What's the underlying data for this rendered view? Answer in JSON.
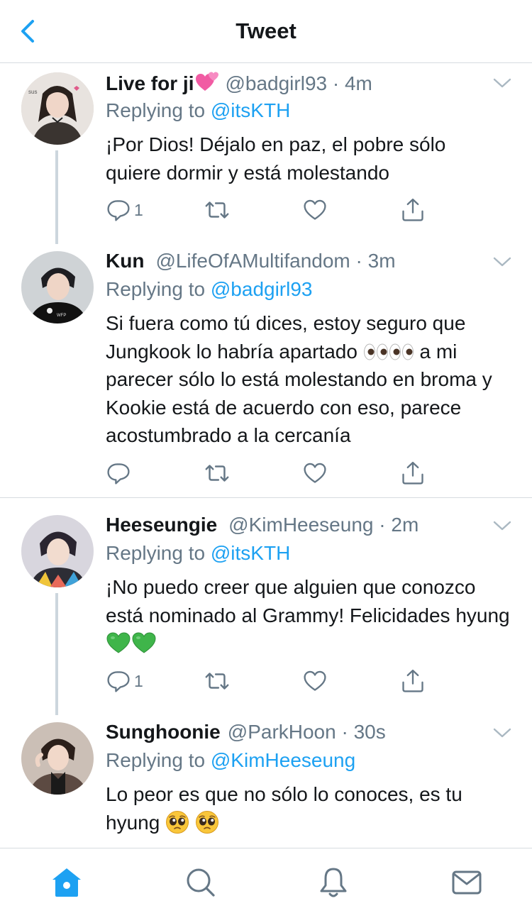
{
  "header": {
    "title": "Tweet"
  },
  "tweets": [
    {
      "name": "Live for ji",
      "handle": "@badgirl93",
      "time": "· 4m",
      "replying_prefix": "Replying to",
      "replying_to": "@itsKTH",
      "text": "¡Por Dios! Déjalo en paz, el pobre sólo quiere dormir y está molestando",
      "reply_count": "1"
    },
    {
      "name": "Kun",
      "handle": "@LifeOfAMultifandom",
      "time": "· 3m",
      "replying_prefix": "Replying to",
      "replying_to": "@badgirl93",
      "text_before_emoji": "Si fuera como tú dices, estoy seguro que Jungkook lo habría apartado",
      "text_after_emoji": "a mi parecer sólo lo está molestando en broma y Kookie está de acuerdo con eso, parece acostumbrado a la cercanía",
      "reply_count": ""
    },
    {
      "name": "Heeseungie",
      "handle": "@KimHeeseung",
      "time": "· 2m",
      "replying_prefix": "Replying to",
      "replying_to": "@itsKTH",
      "text": "¡No puedo creer que alguien que conozco está nominado al Grammy! Felicidades hyung",
      "reply_count": "1"
    },
    {
      "name": "Sunghoonie",
      "handle": "@ParkHoon",
      "time": "· 30s",
      "replying_prefix": "Replying to",
      "replying_to": "@KimHeeseung",
      "text": "Lo peor es que no sólo lo conoces, es tu hyung"
    }
  ],
  "icons": {
    "back": "chevron-left-icon",
    "more": "chevron-down-icon",
    "reply": "speech-bubble-icon",
    "retweet": "retweet-icon",
    "like": "heart-icon",
    "share": "share-icon",
    "home": "home-icon",
    "search": "search-icon",
    "notifications": "bell-icon",
    "messages": "envelope-icon"
  },
  "colors": {
    "accent": "#1da1f2",
    "text": "#14171a",
    "secondary": "#657786",
    "divider": "#d6dbe0",
    "thread_line": "#ccd6dd"
  }
}
